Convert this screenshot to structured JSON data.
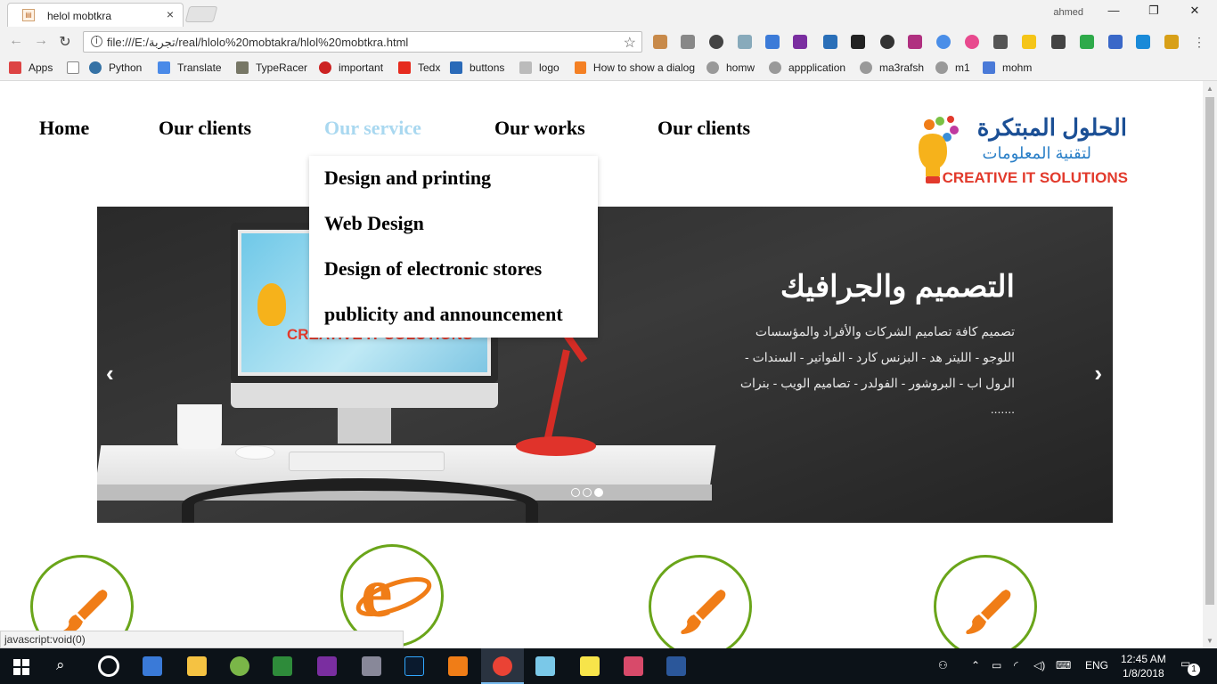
{
  "browser": {
    "tab_title": "helol mobtkra",
    "tab_close": "×",
    "user": "ahmed",
    "url": "file:///E:/تجربة/real/hlolo%20mobtakra/hlol%20mobtkra.html",
    "status_url": "javascript:void(0)",
    "bookmarks": [
      "Apps",
      "Python",
      "Translate",
      "TypeRacer",
      "important",
      "Tedx",
      "buttons",
      "logo",
      "How to show a dialog",
      "homw",
      "appplication",
      "ma3rafsh",
      "m1",
      "mohm"
    ]
  },
  "nav": {
    "items": [
      "Home",
      "Our clients",
      "Our service",
      "Our works",
      "Our clients"
    ],
    "active": "Our service",
    "dropdown": [
      "Design and printing",
      "Web Design",
      "Design of electronic stores",
      "publicity and announcement"
    ]
  },
  "logo": {
    "arabic_name": "الحلول المبتكرة",
    "arabic_sub": "لتقنية المعلومات",
    "english": "CREATIVE IT SOLUTIONS"
  },
  "slider": {
    "title": "التصميم والجرافيك",
    "text": "تصميم كافة تصاميم الشركات والأفراد والمؤسسات اللوجو - الليتر هد - البزنس كارد - الفواتير - السندات - الرول اب - البروشور - الفولدر - تصاميم الويب - بنرات .......",
    "prev": "‹",
    "next": "›",
    "monitor_brand": "CREATIVE IT SOLUTIONS",
    "dots": 3,
    "active_dot": 3
  },
  "services": [
    "brush-icon",
    "ie-icon",
    "brush-icon",
    "brush-icon"
  ],
  "taskbar": {
    "lang": "ENG",
    "time": "12:45 AM",
    "date": "1/8/2018",
    "notifications": "1"
  },
  "colors": {
    "accent_active": "#a9d8f0",
    "service_ring": "#6aa51a",
    "icon_orange": "#f07d17",
    "logo_red": "#e23a2c",
    "logo_blue": "#1b4f95"
  }
}
